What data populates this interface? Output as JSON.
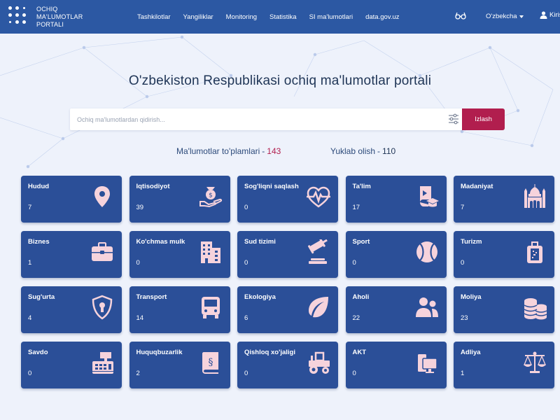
{
  "header": {
    "logo_lines": [
      "OCHIQ",
      "MA'LUMOTLAR",
      "PORTALI"
    ],
    "nav": [
      "Tashkilotlar",
      "Yangiliklar",
      "Monitoring",
      "Statistika",
      "SI ma'lumotlari",
      "data.gov.uz"
    ],
    "language": "O'zbekcha",
    "login": "Kirish",
    "accessibility_icon": "glasses-icon"
  },
  "main": {
    "title": "O'zbekiston Respublikasi ochiq ma'lumotlar portali",
    "search": {
      "placeholder": "Ochiq ma'lumotlardan qidirish...",
      "value": "",
      "button": "Izlash"
    },
    "stats": [
      {
        "label": "Ma'lumotlar to'plamlari",
        "value": "143"
      },
      {
        "label": "Yuklab olish",
        "value": "110"
      }
    ]
  },
  "categories": [
    {
      "name": "Hudud",
      "count": "7",
      "icon": "map-pin-icon"
    },
    {
      "name": "Iqtisodiyot",
      "count": "39",
      "icon": "money-hand-icon"
    },
    {
      "name": "Sog'liqni saqlash",
      "count": "0",
      "icon": "heart-pulse-icon"
    },
    {
      "name": "Ta'lim",
      "count": "17",
      "icon": "book-graduation-icon"
    },
    {
      "name": "Madaniyat",
      "count": "7",
      "icon": "mosque-icon"
    },
    {
      "name": "Biznes",
      "count": "1",
      "icon": "briefcase-icon"
    },
    {
      "name": "Ko'chmas mulk",
      "count": "0",
      "icon": "buildings-icon"
    },
    {
      "name": "Sud tizimi",
      "count": "0",
      "icon": "gavel-icon"
    },
    {
      "name": "Sport",
      "count": "0",
      "icon": "ball-icon"
    },
    {
      "name": "Turizm",
      "count": "0",
      "icon": "suitcase-icon"
    },
    {
      "name": "Sug'urta",
      "count": "4",
      "icon": "shield-lock-icon"
    },
    {
      "name": "Transport",
      "count": "14",
      "icon": "bus-icon"
    },
    {
      "name": "Ekologiya",
      "count": "6",
      "icon": "leaf-icon"
    },
    {
      "name": "Aholi",
      "count": "22",
      "icon": "people-icon"
    },
    {
      "name": "Moliya",
      "count": "23",
      "icon": "coins-icon"
    },
    {
      "name": "Savdo",
      "count": "0",
      "icon": "cash-register-icon"
    },
    {
      "name": "Huquqbuzarlik",
      "count": "2",
      "icon": "law-book-icon"
    },
    {
      "name": "Qishloq xo'jaligi",
      "count": "0",
      "icon": "tractor-icon"
    },
    {
      "name": "AKT",
      "count": "0",
      "icon": "devices-icon"
    },
    {
      "name": "Adliya",
      "count": "1",
      "icon": "scales-icon"
    }
  ],
  "colors": {
    "header": "#2c58a3",
    "card": "#2b4f98",
    "accent": "#b11e4e",
    "icon": "#f6d3dc",
    "background": "#eef2fb"
  }
}
